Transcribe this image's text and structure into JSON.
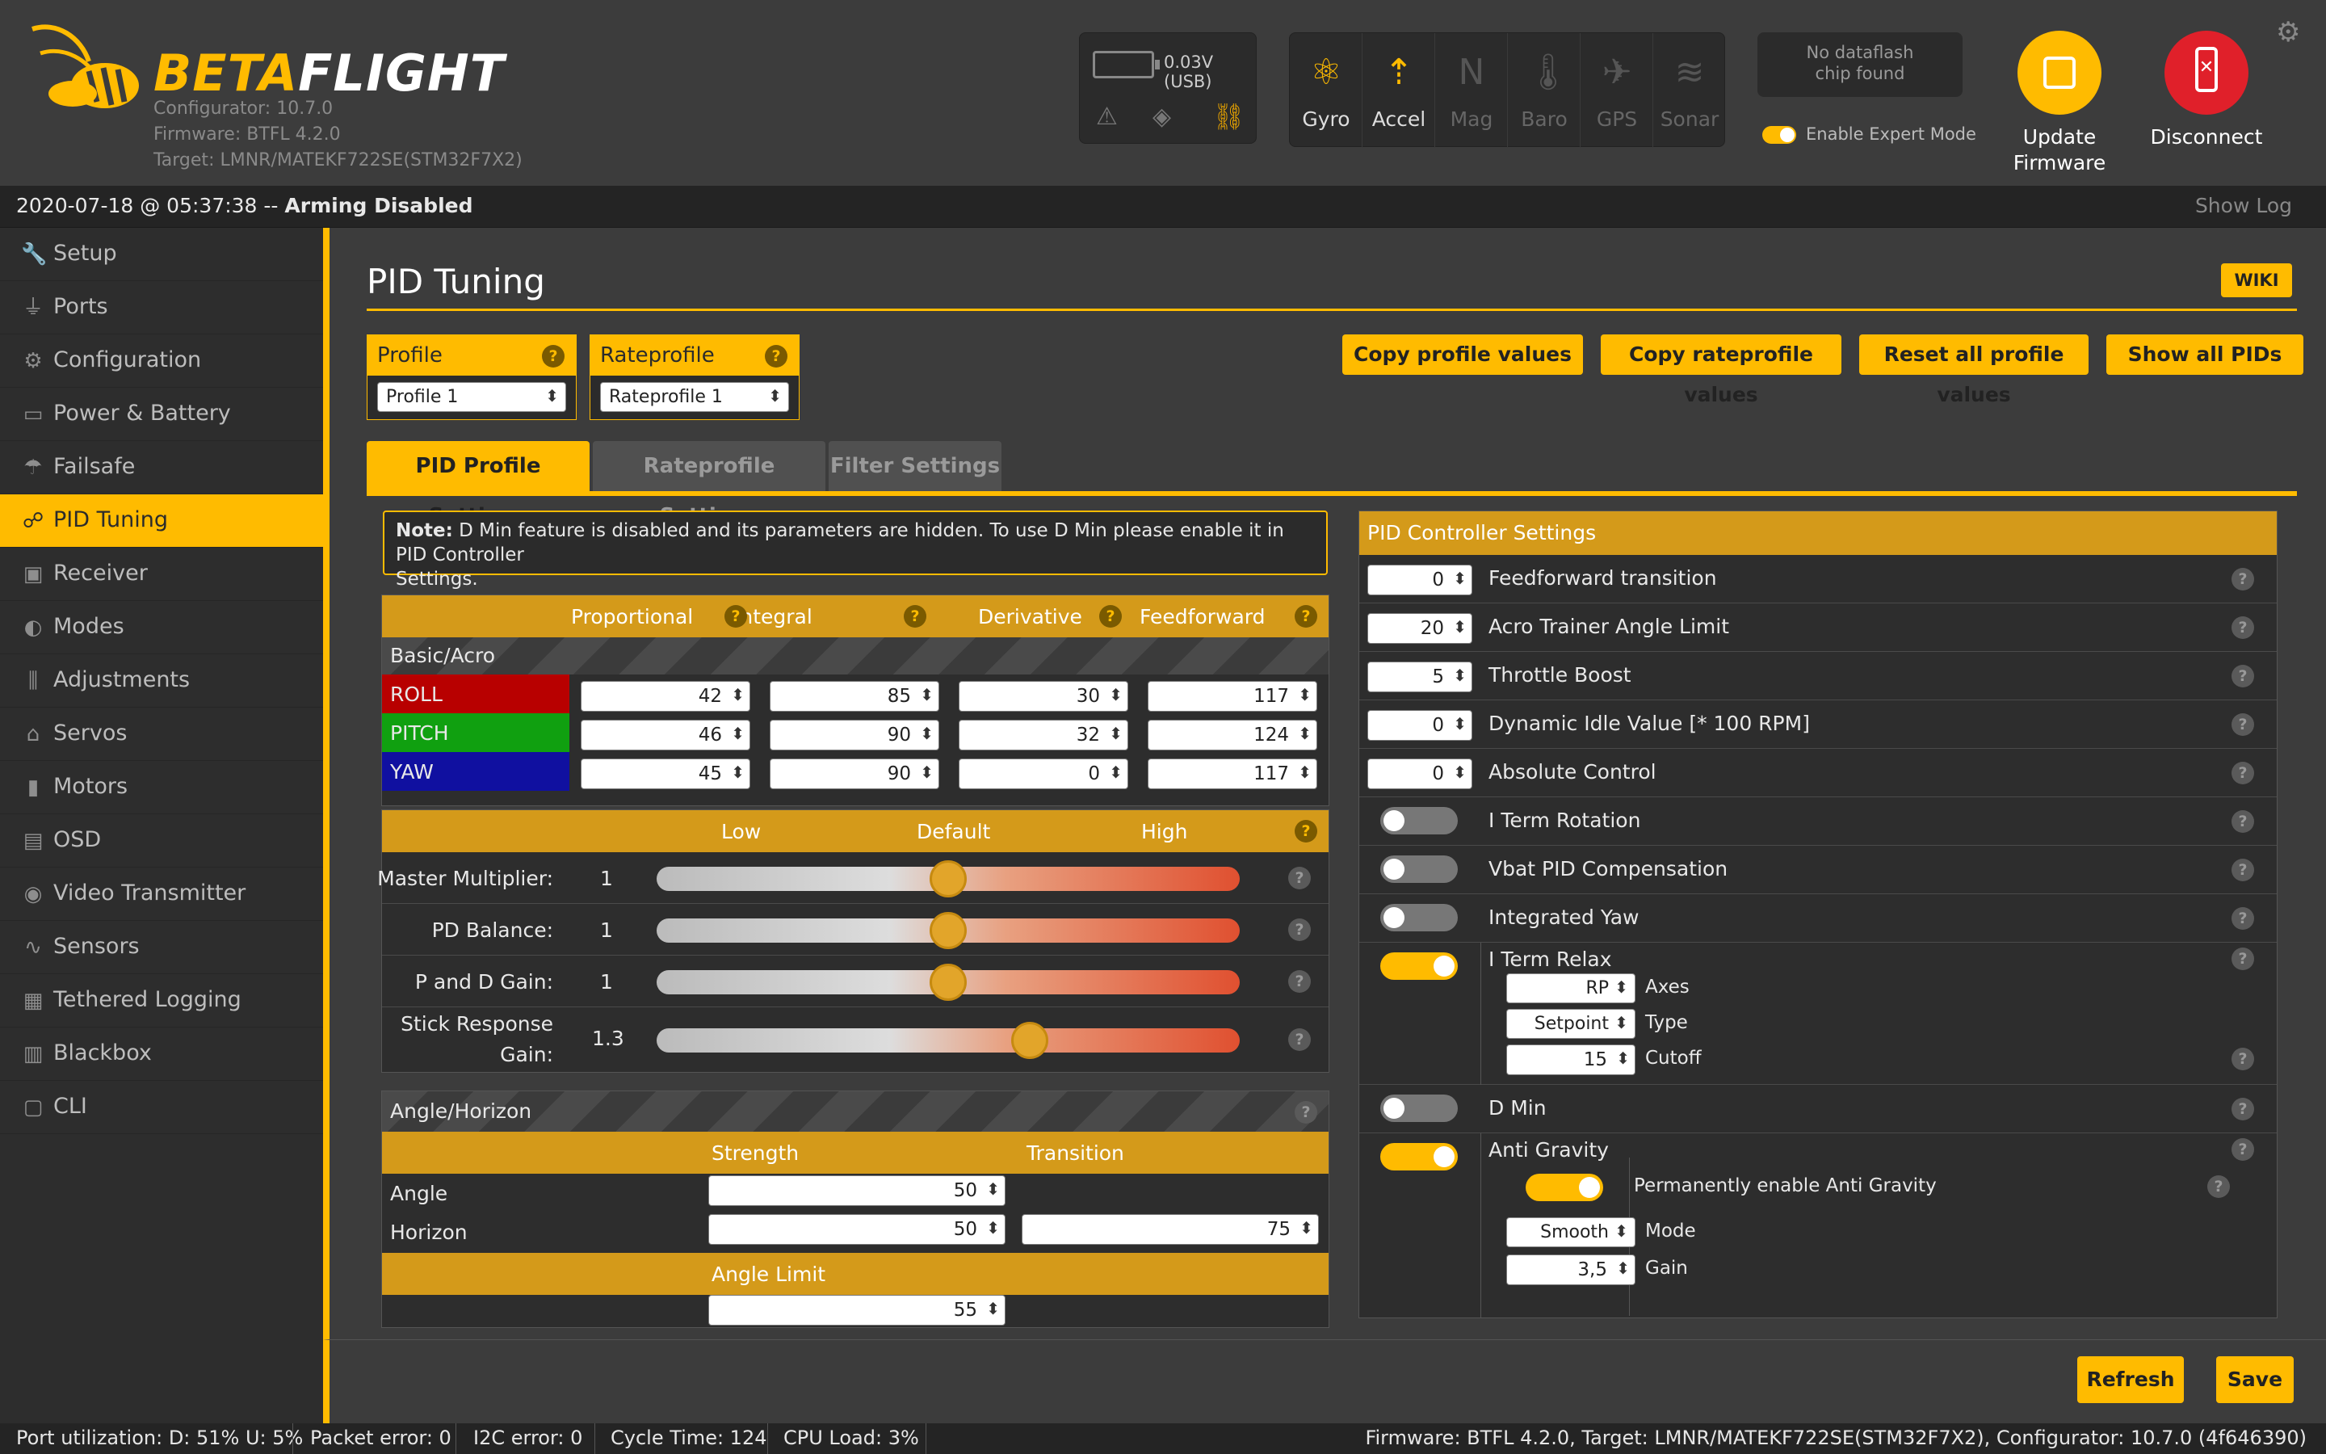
{
  "header": {
    "logo_text_b": "BETA",
    "logo_text_f": "FLIGHT",
    "configurator": "Configurator: 10.7.0",
    "firmware": "Firmware: BTFL 4.2.0",
    "target": "Target: LMNR/MATEKF722SE(STM32F7X2)",
    "battery_text": "0.03V (USB)",
    "sensors": [
      "Gyro",
      "Accel",
      "Mag",
      "Baro",
      "GPS",
      "Sonar"
    ],
    "dataflash_line1": "No dataflash",
    "dataflash_line2": "chip found",
    "expert_mode": "Enable Expert Mode",
    "update_line1": "Update",
    "update_line2": "Firmware",
    "disconnect": "Disconnect"
  },
  "statusbar": {
    "status": "2020-07-18 @ 05:37:38 -- ",
    "status_bold": "Arming Disabled",
    "show_log": "Show Log"
  },
  "nav": [
    "Setup",
    "Ports",
    "Configuration",
    "Power & Battery",
    "Failsafe",
    "PID Tuning",
    "Receiver",
    "Modes",
    "Adjustments",
    "Servos",
    "Motors",
    "OSD",
    "Video Transmitter",
    "Sensors",
    "Tethered Logging",
    "Blackbox",
    "CLI"
  ],
  "main": {
    "title": "PID Tuning",
    "wiki": "WIKI",
    "profile_label": "Profile",
    "profile_value": "Profile 1",
    "rateprofile_label": "Rateprofile",
    "rateprofile_value": "Rateprofile 1",
    "buttons": [
      "Copy profile values",
      "Copy rateprofile values",
      "Reset all profile values",
      "Show all PIDs"
    ],
    "tabs": [
      "PID Profile Settings",
      "Rateprofile Settings",
      "Filter Settings"
    ],
    "note_bold": "Note:",
    "note_line1": " D Min feature is disabled and its parameters are hidden. To use D Min please enable it in PID Controller",
    "note_line2": "Settings.",
    "pid_headers": [
      "Proportional",
      "Integral",
      "Derivative",
      "Feedforward"
    ],
    "basic_acro": "Basic/Acro",
    "pid_rows": [
      {
        "name": "ROLL",
        "color": "#b80000",
        "values": [
          "42",
          "85",
          "30",
          "117"
        ]
      },
      {
        "name": "PITCH",
        "color": "#10a010",
        "values": [
          "46",
          "90",
          "32",
          "124"
        ]
      },
      {
        "name": "YAW",
        "color": "#1010a0",
        "values": [
          "45",
          "90",
          "0",
          "117"
        ]
      }
    ],
    "slider_headers": [
      "Low",
      "Default",
      "High"
    ],
    "sliders": [
      {
        "label": "Master Multiplier:",
        "label2": "",
        "value": "1",
        "pos": 0.5
      },
      {
        "label": "PD Balance:",
        "label2": "",
        "value": "1",
        "pos": 0.5
      },
      {
        "label": "P and D Gain:",
        "label2": "",
        "value": "1",
        "pos": 0.5
      },
      {
        "label": "Stick Response",
        "label2": "Gain:",
        "value": "1.3",
        "pos": 0.64
      }
    ],
    "angle_horizon": "Angle/Horizon",
    "strength": "Strength",
    "transition": "Transition",
    "angle": "Angle",
    "horizon": "Horizon",
    "angle_strength": "50",
    "horizon_strength": "50",
    "horizon_transition": "75",
    "angle_limit": "Angle Limit",
    "angle_limit_value": "55"
  },
  "pidctrl": {
    "title": "PID Controller Settings",
    "numeric": [
      {
        "value": "0",
        "label": "Feedforward transition"
      },
      {
        "value": "20",
        "label": "Acro Trainer Angle Limit"
      },
      {
        "value": "5",
        "label": "Throttle Boost"
      },
      {
        "value": "0",
        "label": "Dynamic Idle Value [* 100 RPM]"
      },
      {
        "value": "0",
        "label": "Absolute Control"
      }
    ],
    "toggles": [
      {
        "label": "I Term Rotation",
        "on": false
      },
      {
        "label": "Vbat PID Compensation",
        "on": false
      },
      {
        "label": "Integrated Yaw",
        "on": false
      }
    ],
    "iterm_relax": "I Term Relax",
    "itr_axes_value": "RP",
    "itr_axes": "Axes",
    "itr_type_value": "Setpoint",
    "itr_type": "Type",
    "itr_cutoff_value": "15",
    "itr_cutoff": "Cutoff",
    "dmin": "D Min",
    "anti_gravity": "Anti Gravity",
    "ag_perm": "Permanently enable Anti Gravity",
    "ag_mode_value": "Smooth",
    "ag_mode": "Mode",
    "ag_gain_value": "3,5",
    "ag_gain": "Gain"
  },
  "footer": {
    "refresh": "Refresh",
    "save": "Save"
  },
  "bottombar": {
    "port": "Port utilization: D: 51% U: 5%",
    "packet": "Packet error: 0",
    "i2c": "I2C error: 0",
    "cycle": "Cycle Time: 124",
    "cpu": "CPU Load: 3%",
    "right": "Firmware: BTFL 4.2.0, Target: LMNR/MATEKF722SE(STM32F7X2), Configurator: 10.7.0 (4f646390)"
  },
  "colors": {
    "accent": "#ffbb00",
    "update": "#ffbb00",
    "disconnect": "#e0202a"
  }
}
